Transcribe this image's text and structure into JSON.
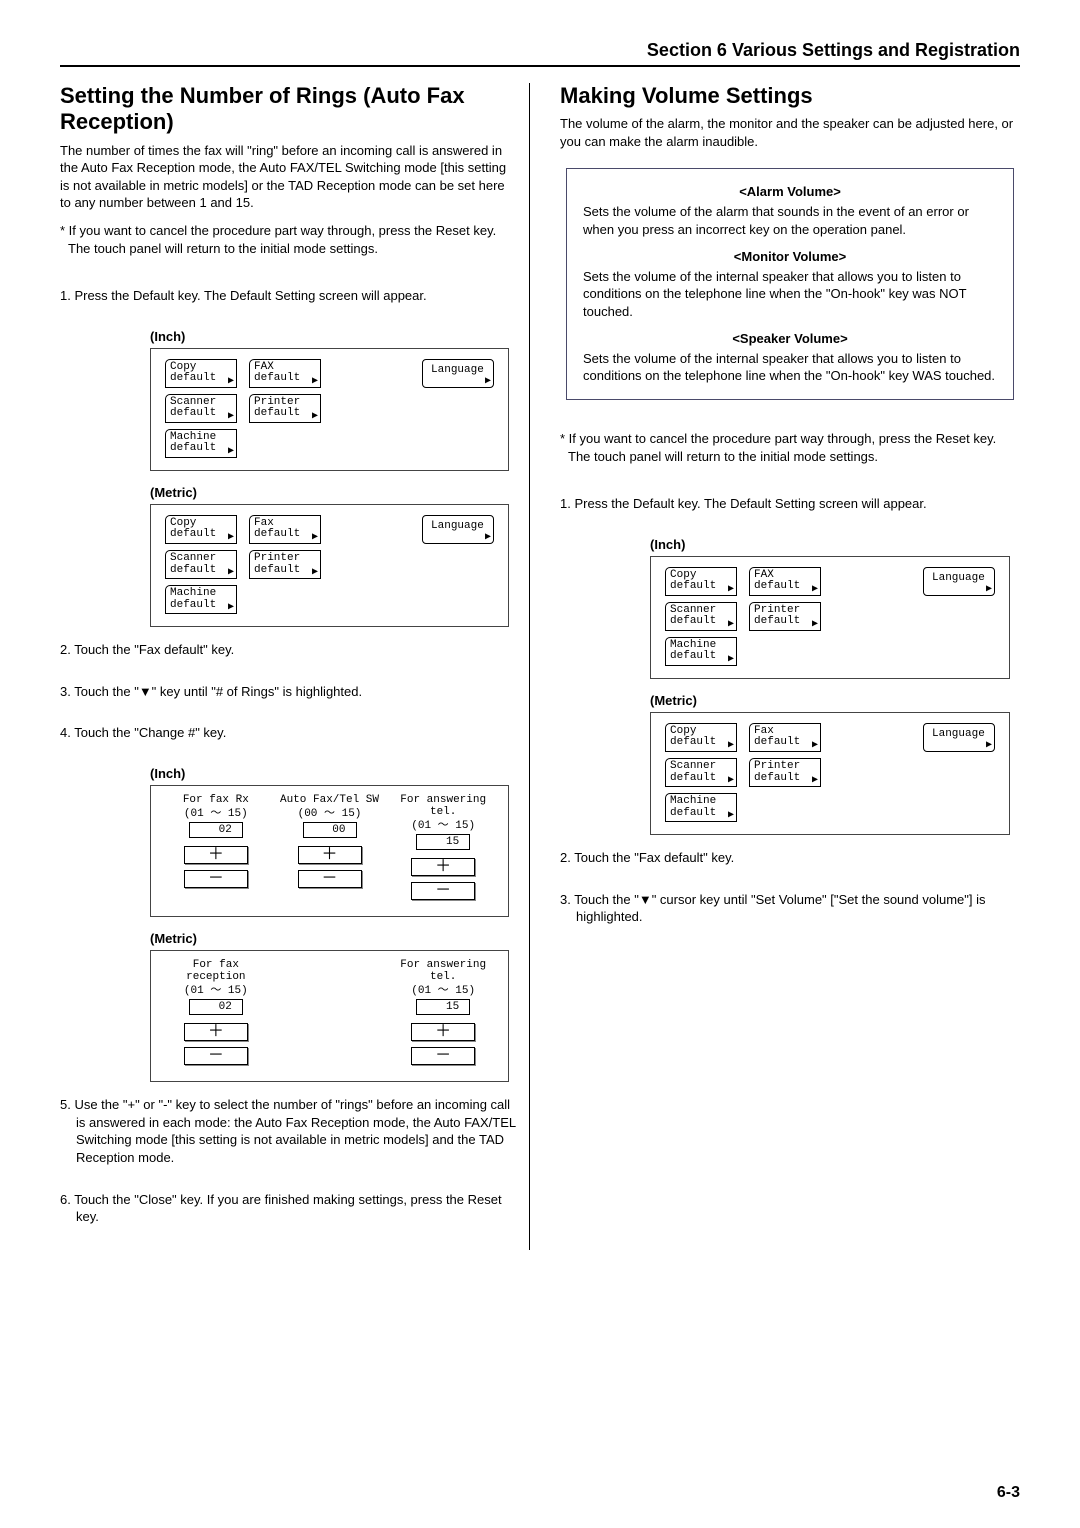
{
  "header": "Section 6  Various Settings and Registration",
  "page_number": "6-3",
  "left": {
    "title": "Setting the Number of Rings (Auto Fax Reception)",
    "intro": "The number of times the fax will \"ring\" before an incoming call is answered in the Auto Fax Reception mode, the Auto FAX/TEL Switching mode [this setting is not available in metric models] or the TAD Reception mode can be set here to any number between 1 and 15.",
    "note": "* If you want to cancel the procedure part way through, press the Reset key. The touch panel will return to the initial mode settings.",
    "step1": "1. Press the Default key. The Default Setting screen will appear.",
    "step2": "2. Touch the \"Fax default\" key.",
    "step3": "3. Touch the \"▼\" key until \"# of Rings\" is highlighted.",
    "step4": "4. Touch the \"Change #\" key.",
    "step5": "5. Use the \"+\" or \"-\" key to select the number of \"rings\" before an incoming call is answered in each mode: the Auto Fax Reception mode, the Auto FAX/TEL Switching mode [this setting is not available in metric models] and the TAD Reception mode.",
    "step6": "6. Touch the \"Close\" key. If you are finished making settings, press the Reset key.",
    "inch_label": "(Inch)",
    "metric_label": "(Metric)",
    "lcd_inch": {
      "copy": "Copy\ndefault",
      "fax": "FAX\ndefault",
      "scanner": "Scanner\ndefault",
      "printer": "Printer\ndefault",
      "machine": "Machine\ndefault",
      "language": "Language"
    },
    "lcd_metric": {
      "copy": "Copy\ndefault",
      "fax": "Fax\ndefault",
      "scanner": "Scanner\ndefault",
      "printer": "Printer\ndefault",
      "machine": "Machine\ndefault",
      "language": "Language"
    },
    "rings_inch": {
      "c1_title": "For fax Rx",
      "c1_range": "(01 ～ 15)",
      "c1_val": "02",
      "c2_title": "Auto Fax/Tel SW",
      "c2_range": "(00 ～ 15)",
      "c2_val": "00",
      "c3_title": "For answering tel.",
      "c3_range": "(01 ～ 15)",
      "c3_val": "15"
    },
    "rings_metric": {
      "c1_title": "For fax reception",
      "c1_range": "(01 ～ 15)",
      "c1_val": "02",
      "c3_title": "For answering tel.",
      "c3_range": "(01 ～ 15)",
      "c3_val": "15"
    },
    "plus": "＋",
    "minus": "－"
  },
  "right": {
    "title": "Making Volume Settings",
    "intro": "The volume of the alarm, the monitor and the speaker can be adjusted here, or you can make the alarm inaudible.",
    "box": {
      "h1": "<Alarm Volume>",
      "p1": "Sets the volume of the alarm that sounds in the event of an error or when you press an incorrect key on the operation panel.",
      "h2": "<Monitor Volume>",
      "p2": "Sets the volume of the internal speaker that allows you to listen to conditions on the telephone line when the \"On-hook\" key was NOT touched.",
      "h3": "<Speaker Volume>",
      "p3": "Sets the volume of the internal speaker that allows you to listen to conditions on the telephone line when the \"On-hook\" key WAS touched."
    },
    "note": "* If you want to cancel the procedure part way through, press the Reset key. The touch panel will return to the initial mode settings.",
    "step1": "1. Press the Default key. The Default Setting screen will appear.",
    "step2": "2. Touch the \"Fax default\" key.",
    "step3": "3. Touch the \"▼\" cursor key until \"Set Volume\" [\"Set the sound volume\"] is highlighted.",
    "inch_label": "(Inch)",
    "metric_label": "(Metric)",
    "lcd_inch": {
      "copy": "Copy\ndefault",
      "fax": "FAX\ndefault",
      "scanner": "Scanner\ndefault",
      "printer": "Printer\ndefault",
      "machine": "Machine\ndefault",
      "language": "Language"
    },
    "lcd_metric": {
      "copy": "Copy\ndefault",
      "fax": "Fax\ndefault",
      "scanner": "Scanner\ndefault",
      "printer": "Printer\ndefault",
      "machine": "Machine\ndefault",
      "language": "Language"
    }
  }
}
